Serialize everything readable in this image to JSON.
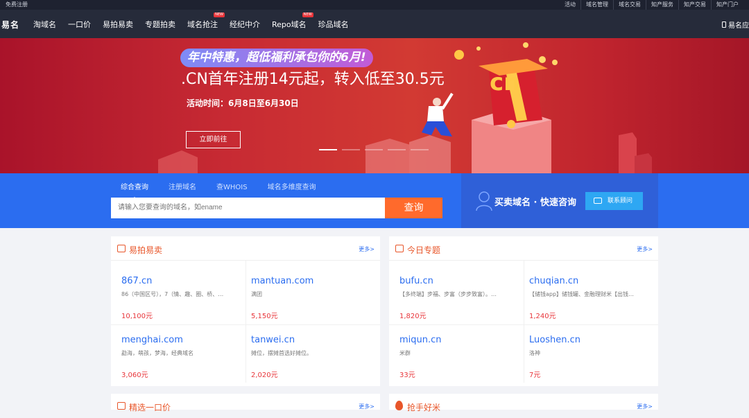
{
  "topbar": {
    "register": "免费注册",
    "links": [
      "活动",
      "域名管理",
      "域名交易",
      "知产服务",
      "知产交易",
      "知产门户"
    ]
  },
  "nav": {
    "logo": "易名",
    "items": [
      {
        "label": "淘域名",
        "new": false
      },
      {
        "label": "一口价",
        "new": false
      },
      {
        "label": "易拍易卖",
        "new": false
      },
      {
        "label": "专题拍卖",
        "new": false
      },
      {
        "label": "域名抢注",
        "new": true
      },
      {
        "label": "经纪中介",
        "new": false
      },
      {
        "label": "Repo域名",
        "new": true
      },
      {
        "label": "珍品域名",
        "new": false
      }
    ],
    "new_badge": "NEW",
    "app": "易名应"
  },
  "banner": {
    "pill": "年中特惠，超低福利承包你的6月!",
    "headline": ".CN首年注册14元起，转入低至30.5元",
    "period": "活动时间：6月8日至6月30日",
    "button": "立即前往",
    "slides": 5,
    "active_slide": 0,
    "box_text": "cn"
  },
  "search": {
    "tabs": [
      "综合查询",
      "注册域名",
      "查WHOIS",
      "域名多维度查询"
    ],
    "active": 0,
    "placeholder": "请输入您要查询的域名，如ename",
    "button": "查询"
  },
  "consult": {
    "text": "买卖域名 · 快速咨询",
    "button": "联系顾问"
  },
  "cards": [
    {
      "title": "易拍易卖",
      "more": "更多>",
      "items": [
        {
          "domain": "867.cn",
          "desc": "86（中国区号），7（情、趣、圈、桥、…",
          "price": "10,100元"
        },
        {
          "domain": "mantuan.com",
          "desc": "满团",
          "price": "5,150元"
        },
        {
          "domain": "menghai.com",
          "desc": "勐海，萌孩，梦海，经典域名",
          "price": "3,060元"
        },
        {
          "domain": "tanwei.cn",
          "desc": "摊位，摆摊首选好摊位。",
          "price": "2,020元"
        }
      ]
    },
    {
      "title": "今日专题",
      "more": "更多>",
      "items": [
        {
          "domain": "bufu.cn",
          "desc": "【多终端】步福、步富（步步致富）。…",
          "price": "1,820元"
        },
        {
          "domain": "chuqian.cn",
          "desc": "【储钱app】储钱罐、金融理财米【出钱…",
          "price": "1,240元"
        },
        {
          "domain": "miqun.cn",
          "desc": "米群",
          "price": "33元"
        },
        {
          "domain": "Luoshen.cn",
          "desc": "洛神",
          "price": "7元"
        }
      ]
    },
    {
      "title": "精选一口价",
      "more": "更多>",
      "items": []
    },
    {
      "title": "抢手好米",
      "more": "更多>",
      "items": []
    }
  ]
}
